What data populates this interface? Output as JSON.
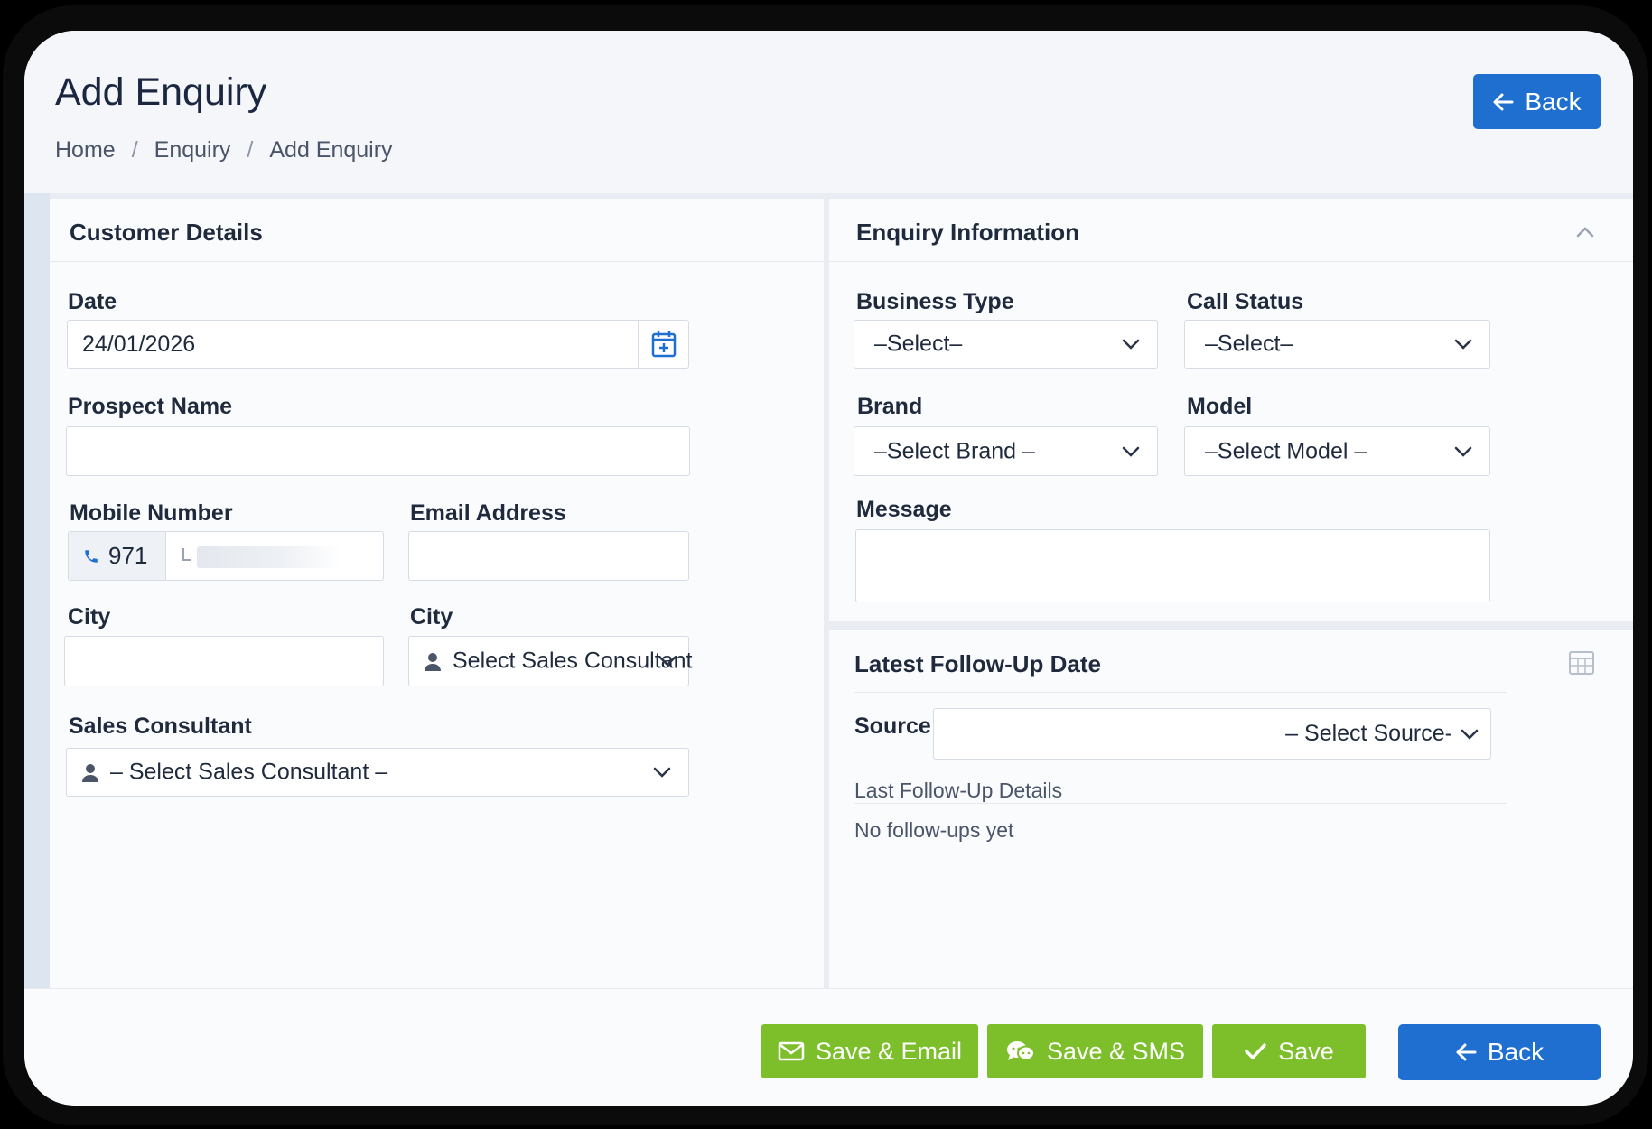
{
  "header": {
    "title": "Add Enquiry",
    "breadcrumb": [
      "Home",
      "Enquiry",
      "Add Enquiry"
    ],
    "separator": "/",
    "back_label": "Back"
  },
  "customer": {
    "title": "Customer Details",
    "date_label": "Date",
    "date_value": "24/01/2026",
    "prospect_label": "Prospect Name",
    "prospect_value": "",
    "mobile_label": "Mobile Number",
    "mobile_prefix": "971",
    "email_label": "Email Address",
    "email_value": "",
    "city_label": "City",
    "city_value": "",
    "city2_label": "City",
    "city2_select": "Select Sales Consultant",
    "consultant_label": "Sales Consultant",
    "consultant_select": "– Select Sales Consultant –"
  },
  "enquiry": {
    "title": "Enquiry Information",
    "business_type_label": "Business Type",
    "business_type_value": "–Select–",
    "call_status_label": "Call Status",
    "call_status_value": "–Select–",
    "brand_label": "Brand",
    "brand_value": "–Select Brand –",
    "model_label": "Model",
    "model_value": "–Select Model –",
    "message_label": "Message",
    "message_value": ""
  },
  "followup": {
    "title": "Latest Follow-Up Date",
    "source_label": "Source",
    "source_value": "– Select Source-",
    "last_details_label": "Last Follow-Up Details",
    "empty_text": "No follow-ups yet"
  },
  "footer": {
    "save_email_label": "Save & Email",
    "save_sms_label": "Save & SMS",
    "save_label": "Save",
    "back_label": "Back"
  },
  "colors": {
    "primary_blue": "#1f6fd1",
    "success_green": "#7cbf2a",
    "text_dark": "#1f2a3d"
  }
}
